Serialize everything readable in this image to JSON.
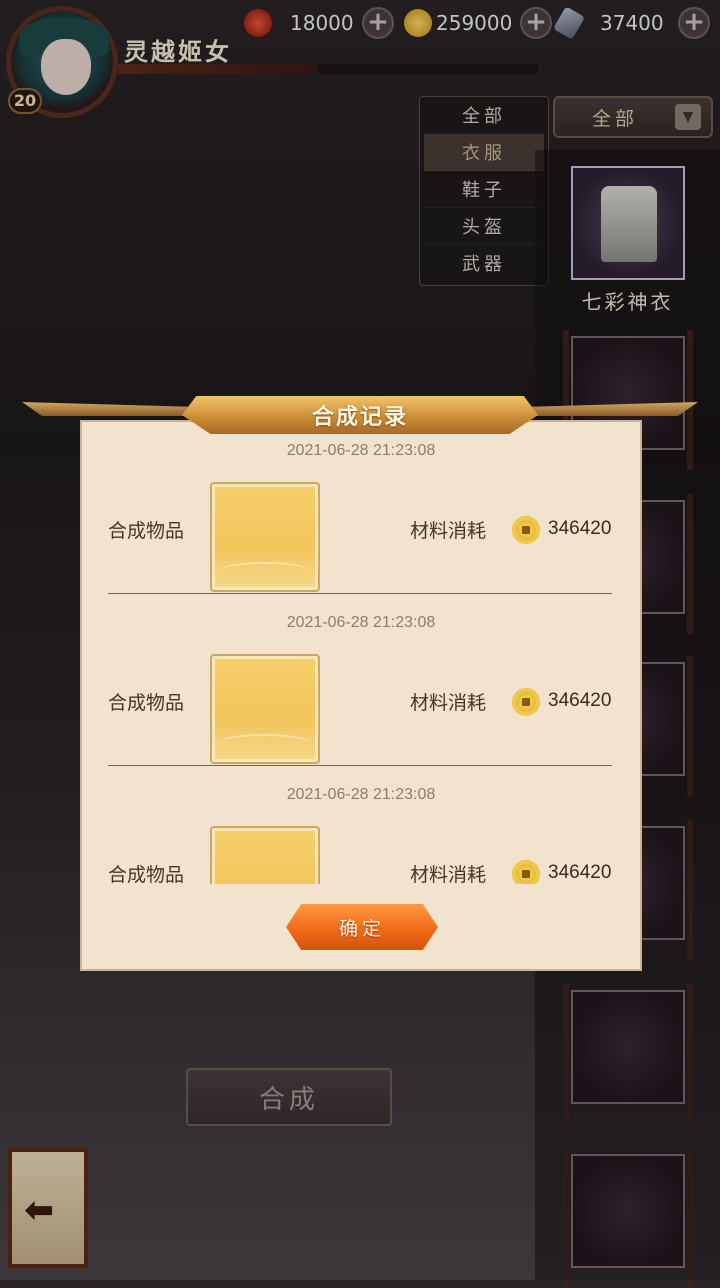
{
  "player": {
    "name": "灵越姬女",
    "level": "20"
  },
  "currencies": [
    {
      "icon": "swirl-gem-icon",
      "value": "18000",
      "color": "#c0392b"
    },
    {
      "icon": "gold-coin-icon",
      "value": "259000",
      "color": "#e2b431"
    },
    {
      "icon": "crystal-icon",
      "value": "37400",
      "color": "#8a8ea0"
    }
  ],
  "filter": {
    "selected": "全部",
    "options": [
      "全部",
      "衣服",
      "鞋子",
      "头盔",
      "武器"
    ],
    "active_index": 1
  },
  "items": {
    "selected_name": "七彩神衣"
  },
  "dialog": {
    "title": "合成记录",
    "confirm_label": "确定",
    "records": [
      {
        "date": "2021-06-28 21:23:08",
        "item_label": "合成物品",
        "cost_label": "材料消耗",
        "cost": "346420"
      },
      {
        "date": "2021-06-28 21:23:08",
        "item_label": "合成物品",
        "cost_label": "材料消耗",
        "cost": "346420"
      },
      {
        "date": "2021-06-28 21:23:08",
        "item_label": "合成物品",
        "cost_label": "材料消耗",
        "cost": "346420"
      }
    ]
  },
  "compose_label": "合成"
}
